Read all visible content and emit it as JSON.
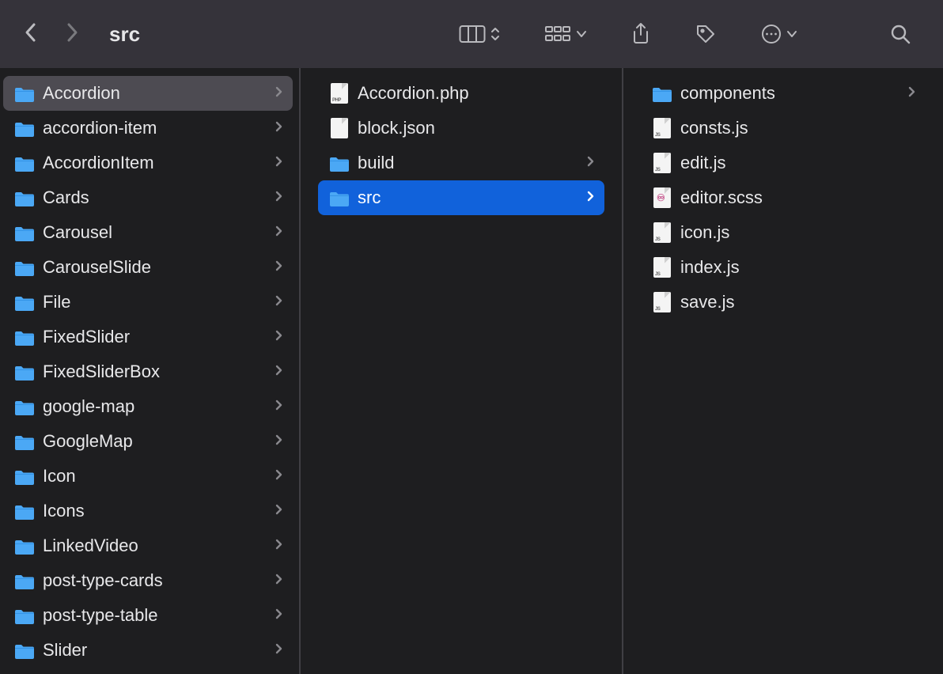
{
  "window": {
    "title": "src"
  },
  "columns": {
    "col1": [
      {
        "name": "Accordion",
        "type": "folder",
        "hasChildren": true,
        "selected": true
      },
      {
        "name": "accordion-item",
        "type": "folder",
        "hasChildren": true
      },
      {
        "name": "AccordionItem",
        "type": "folder",
        "hasChildren": true
      },
      {
        "name": "Cards",
        "type": "folder",
        "hasChildren": true
      },
      {
        "name": "Carousel",
        "type": "folder",
        "hasChildren": true
      },
      {
        "name": "CarouselSlide",
        "type": "folder",
        "hasChildren": true
      },
      {
        "name": "File",
        "type": "folder",
        "hasChildren": true
      },
      {
        "name": "FixedSlider",
        "type": "folder",
        "hasChildren": true
      },
      {
        "name": "FixedSliderBox",
        "type": "folder",
        "hasChildren": true
      },
      {
        "name": "google-map",
        "type": "folder",
        "hasChildren": true
      },
      {
        "name": "GoogleMap",
        "type": "folder",
        "hasChildren": true
      },
      {
        "name": "Icon",
        "type": "folder",
        "hasChildren": true
      },
      {
        "name": "Icons",
        "type": "folder",
        "hasChildren": true
      },
      {
        "name": "LinkedVideo",
        "type": "folder",
        "hasChildren": true
      },
      {
        "name": "post-type-cards",
        "type": "folder",
        "hasChildren": true
      },
      {
        "name": "post-type-table",
        "type": "folder",
        "hasChildren": true
      },
      {
        "name": "Slider",
        "type": "folder",
        "hasChildren": true
      }
    ],
    "col2": [
      {
        "name": "Accordion.php",
        "type": "file",
        "ext": "PHP"
      },
      {
        "name": "block.json",
        "type": "file",
        "ext": ""
      },
      {
        "name": "build",
        "type": "folder",
        "hasChildren": true
      },
      {
        "name": "src",
        "type": "folder",
        "hasChildren": true,
        "selected": true
      }
    ],
    "col3": [
      {
        "name": "components",
        "type": "folder",
        "hasChildren": true
      },
      {
        "name": "consts.js",
        "type": "file",
        "ext": "JS"
      },
      {
        "name": "edit.js",
        "type": "file",
        "ext": "JS"
      },
      {
        "name": "editor.scss",
        "type": "file",
        "ext": "SCSS"
      },
      {
        "name": "icon.js",
        "type": "file",
        "ext": "JS"
      },
      {
        "name": "index.js",
        "type": "file",
        "ext": "JS"
      },
      {
        "name": "save.js",
        "type": "file",
        "ext": "JS"
      }
    ]
  }
}
